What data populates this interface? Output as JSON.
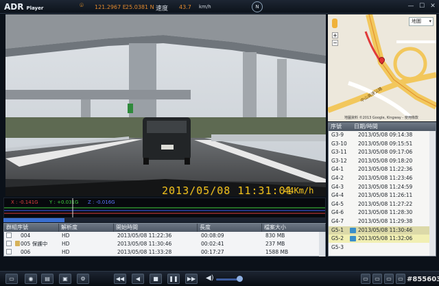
{
  "app": {
    "title_main": "ADR",
    "title_sub": "Player"
  },
  "topbar": {
    "longitude": "121.2967 E",
    "latitude": "25.0381 N",
    "speed_label": "速度",
    "speed_value": "43.7",
    "speed_unit": "km/h",
    "compass": "N"
  },
  "video": {
    "overlay_datetime": "2013/05/08 11:31:01",
    "overlay_speed": "44Km/h"
  },
  "map": {
    "type_select": "地圖",
    "road_label": "中山高速公路",
    "attribution": "地圖資料 ©2013 Google, Kingway - 使用條款"
  },
  "gsensor": {
    "x": "X : -0.141G",
    "y": "Y : +0.031G",
    "z": "Z : -0.016G",
    "colors": {
      "x": "#e04040",
      "y": "#3fcf3f",
      "z": "#4060ff"
    }
  },
  "progress": {
    "fraction": 0.19
  },
  "table": {
    "headers": [
      "群組序號",
      "解析度",
      "開始時間",
      "長度",
      "檔案大小"
    ],
    "rows": [
      {
        "group": "004",
        "res": "HD",
        "start": "2013/05/08 11:22:36",
        "len": "00:08:09",
        "size": "830 MB",
        "locked": false
      },
      {
        "group": "005 保護中",
        "res": "HD",
        "start": "2013/05/08 11:30:46",
        "len": "00:02:41",
        "size": "237 MB",
        "locked": true
      },
      {
        "group": "006",
        "res": "HD",
        "start": "2013/05/08 11:33:28",
        "len": "00:17:27",
        "size": "1588 MB",
        "locked": false
      }
    ]
  },
  "list": {
    "headers": [
      "序號",
      "日期/時間"
    ],
    "items": [
      {
        "id": "G3-9",
        "dt": "2013/05/08 09:14:38",
        "state": ""
      },
      {
        "id": "G3-10",
        "dt": "2013/05/08 09:15:51",
        "state": ""
      },
      {
        "id": "G3-11",
        "dt": "2013/05/08 09:17:06",
        "state": ""
      },
      {
        "id": "G3-12",
        "dt": "2013/05/08 09:18:20",
        "state": ""
      },
      {
        "id": "G4-1",
        "dt": "2013/05/08 11:22:36",
        "state": ""
      },
      {
        "id": "G4-2",
        "dt": "2013/05/08 11:23:46",
        "state": ""
      },
      {
        "id": "G4-3",
        "dt": "2013/05/08 11:24:59",
        "state": ""
      },
      {
        "id": "G4-4",
        "dt": "2013/05/08 11:26:11",
        "state": ""
      },
      {
        "id": "G4-5",
        "dt": "2013/05/08 11:27:22",
        "state": ""
      },
      {
        "id": "G4-6",
        "dt": "2013/05/08 11:28:30",
        "state": ""
      },
      {
        "id": "G4-7",
        "dt": "2013/05/08 11:29:38",
        "state": ""
      },
      {
        "id": "G5-1",
        "dt": "2013/05/08 11:30:46",
        "state": "sel1"
      },
      {
        "id": "G5-2",
        "dt": "2013/05/08 11:32:06",
        "state": "sel2"
      },
      {
        "id": "G5-3",
        "dt": "",
        "state": ""
      }
    ]
  },
  "watermark": "#855603"
}
